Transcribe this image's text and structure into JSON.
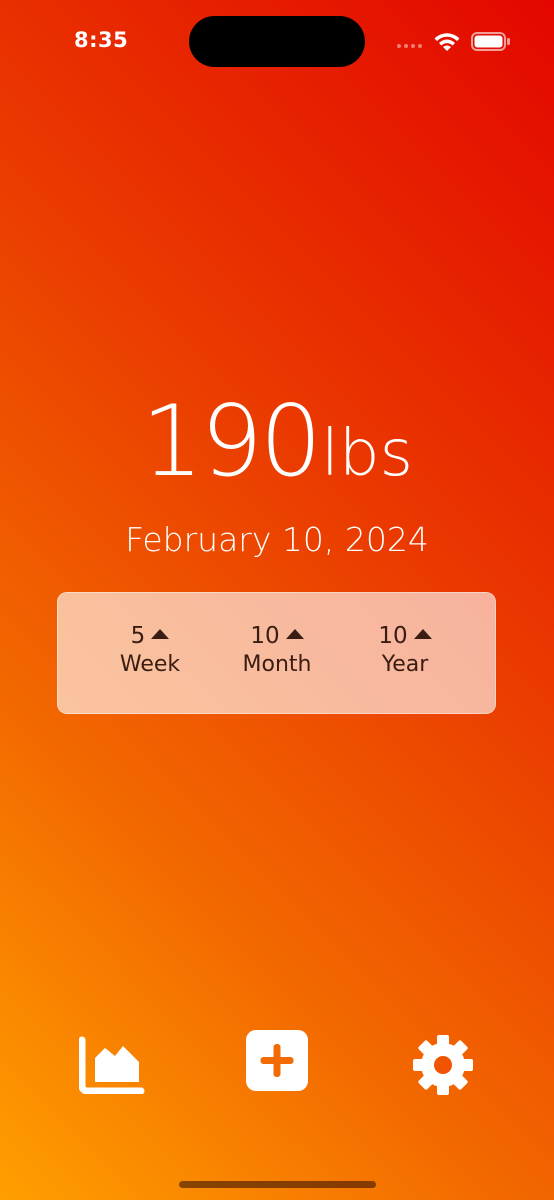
{
  "status_bar": {
    "time": "8:35",
    "icons": [
      "cellular-signal-icon",
      "wifi-icon",
      "battery-icon"
    ]
  },
  "weight": {
    "value": "190",
    "unit": "lbs"
  },
  "date": "February 10, 2024",
  "stats": [
    {
      "value": "5",
      "label": "Week",
      "trend": "up"
    },
    {
      "value": "10",
      "label": "Month",
      "trend": "up"
    },
    {
      "value": "10",
      "label": "Year",
      "trend": "up"
    }
  ],
  "tab_bar": {
    "items": [
      "chart-icon",
      "add-entry-icon",
      "settings-gear-icon"
    ]
  },
  "colors": {
    "gradient_top_right": "#e30600",
    "gradient_bottom_left": "#ff9f00",
    "card_text": "#3a1d12",
    "accent_add": "#f36a00"
  }
}
